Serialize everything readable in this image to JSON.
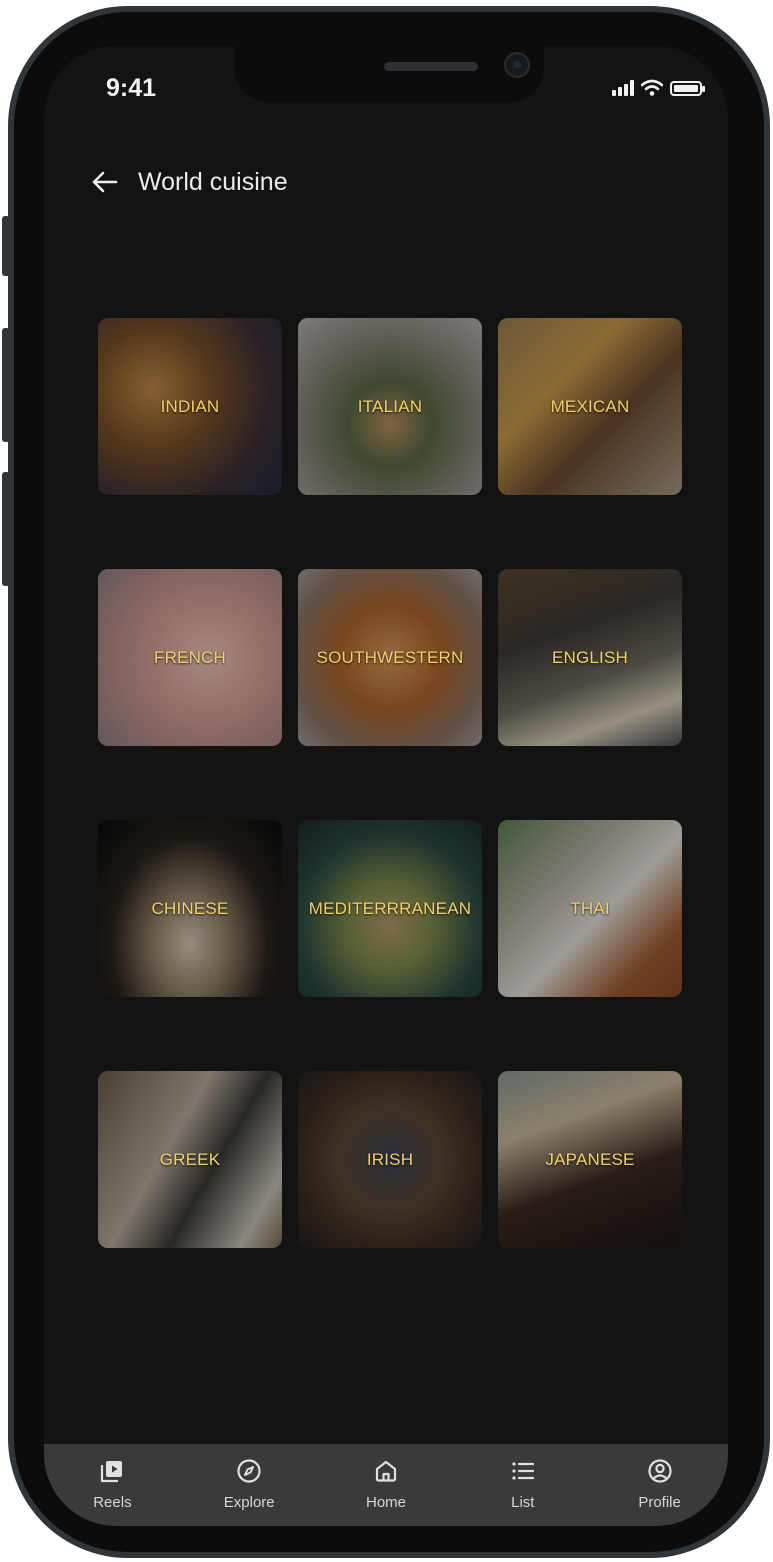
{
  "status_bar": {
    "time": "9:41"
  },
  "header": {
    "title": "World cuisine"
  },
  "cuisines": [
    {
      "label": "INDIAN"
    },
    {
      "label": "ITALIAN"
    },
    {
      "label": "MEXICAN"
    },
    {
      "label": "FRENCH"
    },
    {
      "label": "SOUTHWESTERN"
    },
    {
      "label": "ENGLISH"
    },
    {
      "label": "CHINESE"
    },
    {
      "label": "MEDITERRRANEAN"
    },
    {
      "label": "THAI"
    },
    {
      "label": "GREEK"
    },
    {
      "label": "IRISH"
    },
    {
      "label": "JAPANESE"
    }
  ],
  "nav": {
    "items": [
      {
        "label": "Reels",
        "icon": "play-icon"
      },
      {
        "label": "Explore",
        "icon": "compass-icon"
      },
      {
        "label": "Home",
        "icon": "home-icon"
      },
      {
        "label": "List",
        "icon": "list-icon"
      },
      {
        "label": "Profile",
        "icon": "profile-icon"
      }
    ]
  },
  "colors": {
    "background": "#131314",
    "label": "#f2d268",
    "navbar": "#3a3a3a"
  }
}
